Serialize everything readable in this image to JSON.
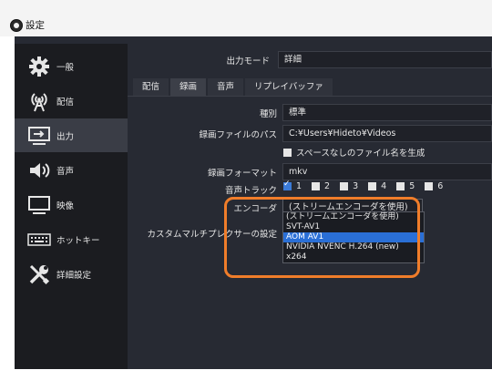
{
  "window": {
    "title": "設定"
  },
  "sidebar": {
    "items": [
      {
        "label": "一般",
        "icon": "gear-icon"
      },
      {
        "label": "配信",
        "icon": "broadcast-antenna-icon"
      },
      {
        "label": "出力",
        "icon": "output-monitor-icon",
        "active": true
      },
      {
        "label": "音声",
        "icon": "speaker-icon"
      },
      {
        "label": "映像",
        "icon": "monitor-icon"
      },
      {
        "label": "ホットキー",
        "icon": "keyboard-icon"
      },
      {
        "label": "詳細設定",
        "icon": "tools-icon"
      }
    ]
  },
  "output": {
    "mode_label": "出力モード",
    "mode_value": "詳細",
    "tabs": [
      "配信",
      "録画",
      "音声",
      "リプレイバッファ"
    ],
    "active_tab": "録画",
    "type_label": "種別",
    "type_value": "標準",
    "path_label": "録画ファイルのパス",
    "path_value": "C:¥Users¥Hideto¥Videos",
    "nospace_label": "スペースなしのファイル名を生成",
    "format_label": "録画フォーマット",
    "format_value": "mkv",
    "tracks_label": "音声トラック",
    "tracks": [
      "1",
      "2",
      "3",
      "4",
      "5",
      "6"
    ],
    "encoder_label": "エンコーダ",
    "encoder_value": "(ストリームエンコーダを使用)",
    "muxer_label": "カスタムマルチプレクサーの設定",
    "encoder_options": [
      "(ストリームエンコーダを使用)",
      "SVT-AV1",
      "AOM AV1",
      "NVIDIA NVENC H.264 (new)",
      "x264"
    ],
    "selected_option": "AOM AV1"
  },
  "colors": {
    "accent": "#2a6fd6",
    "highlight": "#f07d2a",
    "background": "#272a33",
    "sidebar": "#1b1c20"
  }
}
